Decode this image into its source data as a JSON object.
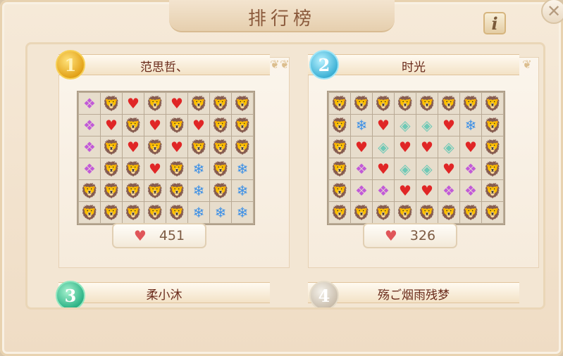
{
  "title": "排行榜",
  "info_label": "i",
  "close_label": "✕",
  "score_icon": "♥",
  "glyphs": {
    "L": "🦁",
    "H": "♥",
    "I": "❄",
    "A": "❖",
    "O": "◈"
  },
  "glyph_names": {
    "L": "lion-gem",
    "H": "heart-gem",
    "I": "ice-crystal-gem",
    "A": "amethyst-gem",
    "O": "opal-gem"
  },
  "ranks": [
    {
      "rank": "1",
      "name": "范思哲、",
      "score": "451",
      "board": [
        [
          "A",
          "L",
          "H",
          "L",
          "H",
          "L",
          "L",
          "L"
        ],
        [
          "A",
          "H",
          "L",
          "H",
          "L",
          "H",
          "L",
          "L"
        ],
        [
          "A",
          "L",
          "H",
          "L",
          "H",
          "L",
          "L",
          "L"
        ],
        [
          "A",
          "L",
          "L",
          "H",
          "L",
          "I",
          "L",
          "I"
        ],
        [
          "L",
          "L",
          "L",
          "L",
          "L",
          "I",
          "L",
          "I"
        ],
        [
          "L",
          "L",
          "L",
          "L",
          "L",
          "I",
          "I",
          "I"
        ]
      ]
    },
    {
      "rank": "2",
      "name": "时光",
      "score": "326",
      "board": [
        [
          "L",
          "L",
          "L",
          "L",
          "L",
          "L",
          "L",
          "L"
        ],
        [
          "L",
          "I",
          "H",
          "O",
          "O",
          "H",
          "I",
          "L"
        ],
        [
          "L",
          "H",
          "O",
          "H",
          "H",
          "O",
          "H",
          "L"
        ],
        [
          "L",
          "A",
          "H",
          "O",
          "O",
          "H",
          "A",
          "L"
        ],
        [
          "L",
          "A",
          "A",
          "H",
          "H",
          "A",
          "A",
          "L"
        ],
        [
          "L",
          "L",
          "L",
          "L",
          "L",
          "L",
          "L",
          "L"
        ]
      ]
    },
    {
      "rank": "3",
      "name": "柔小沐"
    },
    {
      "rank": "4",
      "name": "殇ご烟雨残梦"
    }
  ]
}
